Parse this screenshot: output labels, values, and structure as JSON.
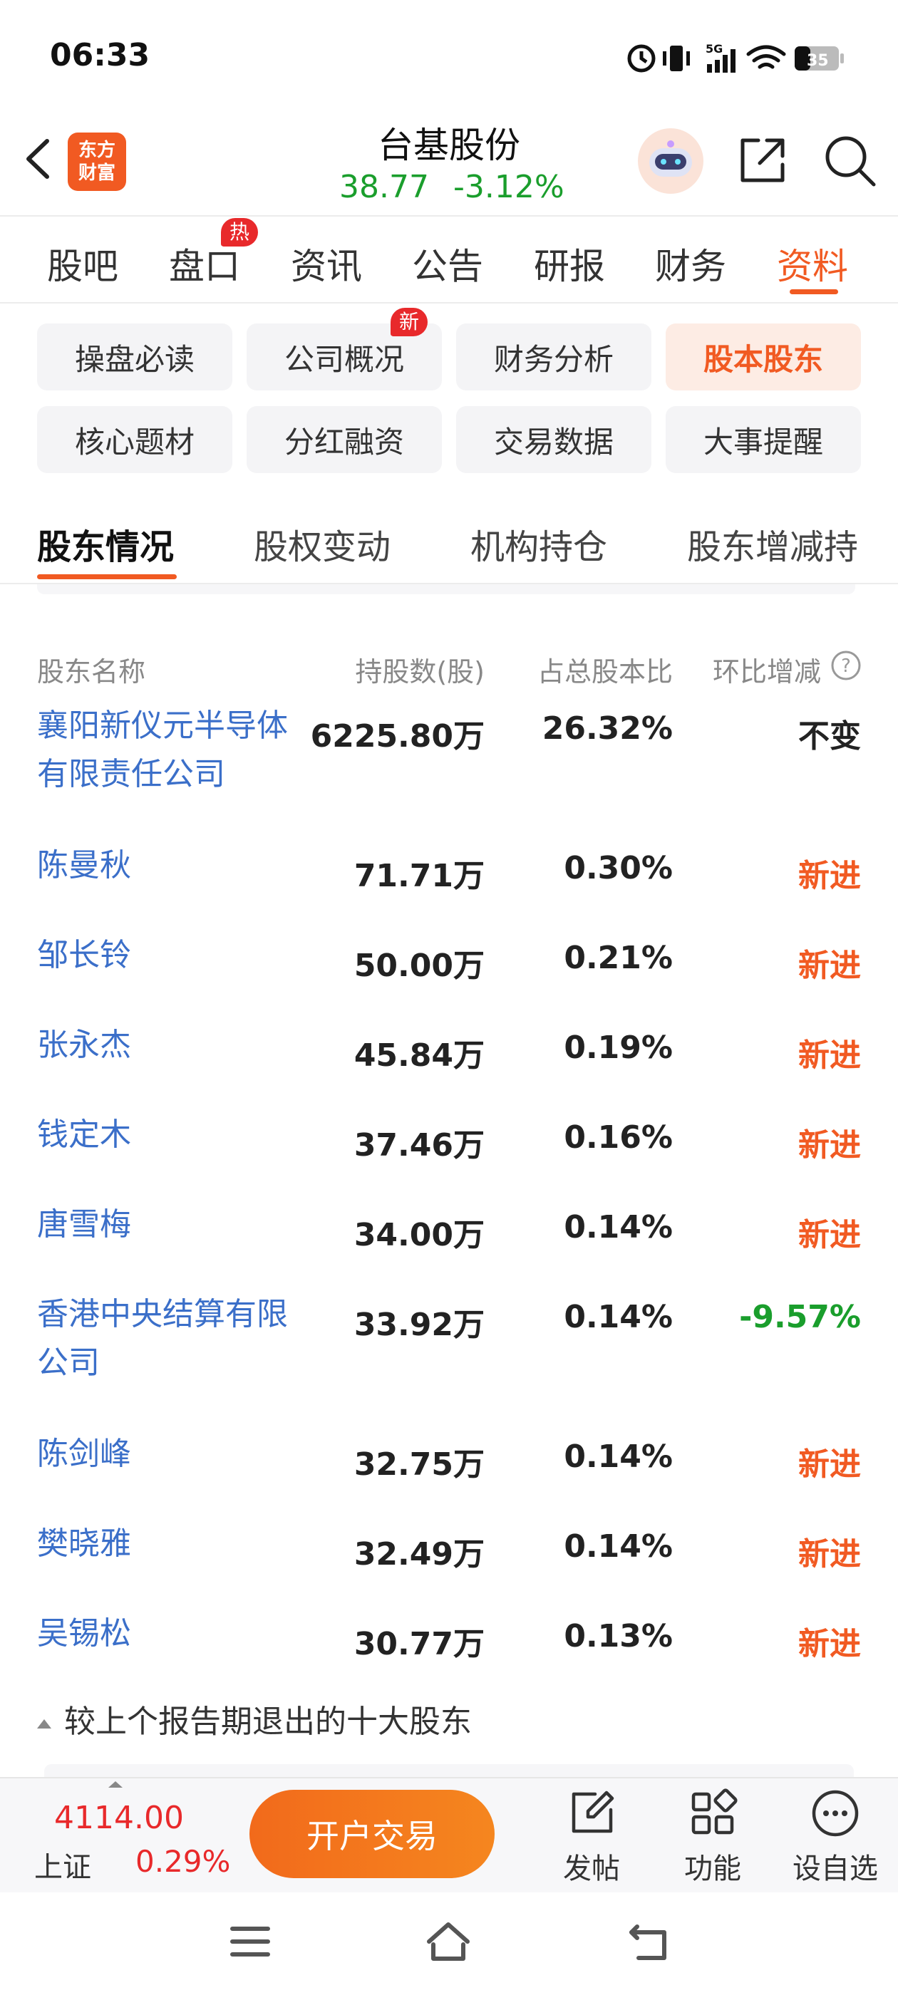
{
  "status_bar": {
    "time": "06:33",
    "battery": "35"
  },
  "header": {
    "logo_line1": "东方",
    "logo_line2": "财富",
    "stock_name": "台基股份",
    "price": "38.77",
    "change": "-3.12%"
  },
  "main_tabs": [
    {
      "label": "股吧"
    },
    {
      "label": "盘口",
      "badge": "热"
    },
    {
      "label": "资讯"
    },
    {
      "label": "公告"
    },
    {
      "label": "研报"
    },
    {
      "label": "财务"
    },
    {
      "label": "资料",
      "active": true
    }
  ],
  "sub_buttons": [
    {
      "label": "操盘必读"
    },
    {
      "label": "公司概况",
      "badge": "新"
    },
    {
      "label": "财务分析"
    },
    {
      "label": "股本股东",
      "active": true
    },
    {
      "label": "核心题材"
    },
    {
      "label": "分红融资"
    },
    {
      "label": "交易数据"
    },
    {
      "label": "大事提醒"
    }
  ],
  "section_tabs": [
    {
      "label": "股东情况",
      "active": true
    },
    {
      "label": "股权变动"
    },
    {
      "label": "机构持仓"
    },
    {
      "label": "股东增减持"
    }
  ],
  "table": {
    "headers": {
      "name": "股东名称",
      "shares": "持股数(股)",
      "ratio": "占总股本比",
      "change": "环比增减"
    },
    "rows": [
      {
        "name": "襄阳新仪元半导体有限责任公司",
        "shares": "6225.80万",
        "ratio": "26.32%",
        "change": "不变",
        "change_color": "#222222"
      },
      {
        "name": "陈曼秋",
        "shares": "71.71万",
        "ratio": "0.30%",
        "change": "新进",
        "change_color": "#f15a22"
      },
      {
        "name": "邹长铃",
        "shares": "50.00万",
        "ratio": "0.21%",
        "change": "新进",
        "change_color": "#f15a22"
      },
      {
        "name": "张永杰",
        "shares": "45.84万",
        "ratio": "0.19%",
        "change": "新进",
        "change_color": "#f15a22"
      },
      {
        "name": "钱定木",
        "shares": "37.46万",
        "ratio": "0.16%",
        "change": "新进",
        "change_color": "#f15a22"
      },
      {
        "name": "唐雪梅",
        "shares": "34.00万",
        "ratio": "0.14%",
        "change": "新进",
        "change_color": "#f15a22"
      },
      {
        "name": "香港中央结算有限公司",
        "shares": "33.92万",
        "ratio": "0.14%",
        "change": "-9.57%",
        "change_color": "#1a9e2c"
      },
      {
        "name": "陈剑峰",
        "shares": "32.75万",
        "ratio": "0.14%",
        "change": "新进",
        "change_color": "#f15a22"
      },
      {
        "name": "樊晓雅",
        "shares": "32.49万",
        "ratio": "0.14%",
        "change": "新进",
        "change_color": "#f15a22"
      },
      {
        "name": "吴锡松",
        "shares": "30.77万",
        "ratio": "0.13%",
        "change": "新进",
        "change_color": "#f15a22"
      }
    ]
  },
  "exit_toggle": "较上个报告期退出的十大股东",
  "bottom_bar": {
    "index_value": "4114.00",
    "index_name": "上证",
    "index_change": "0.29%",
    "trade_button": "开户交易",
    "post": "发帖",
    "functions": "功能",
    "add_watch": "设自选"
  }
}
